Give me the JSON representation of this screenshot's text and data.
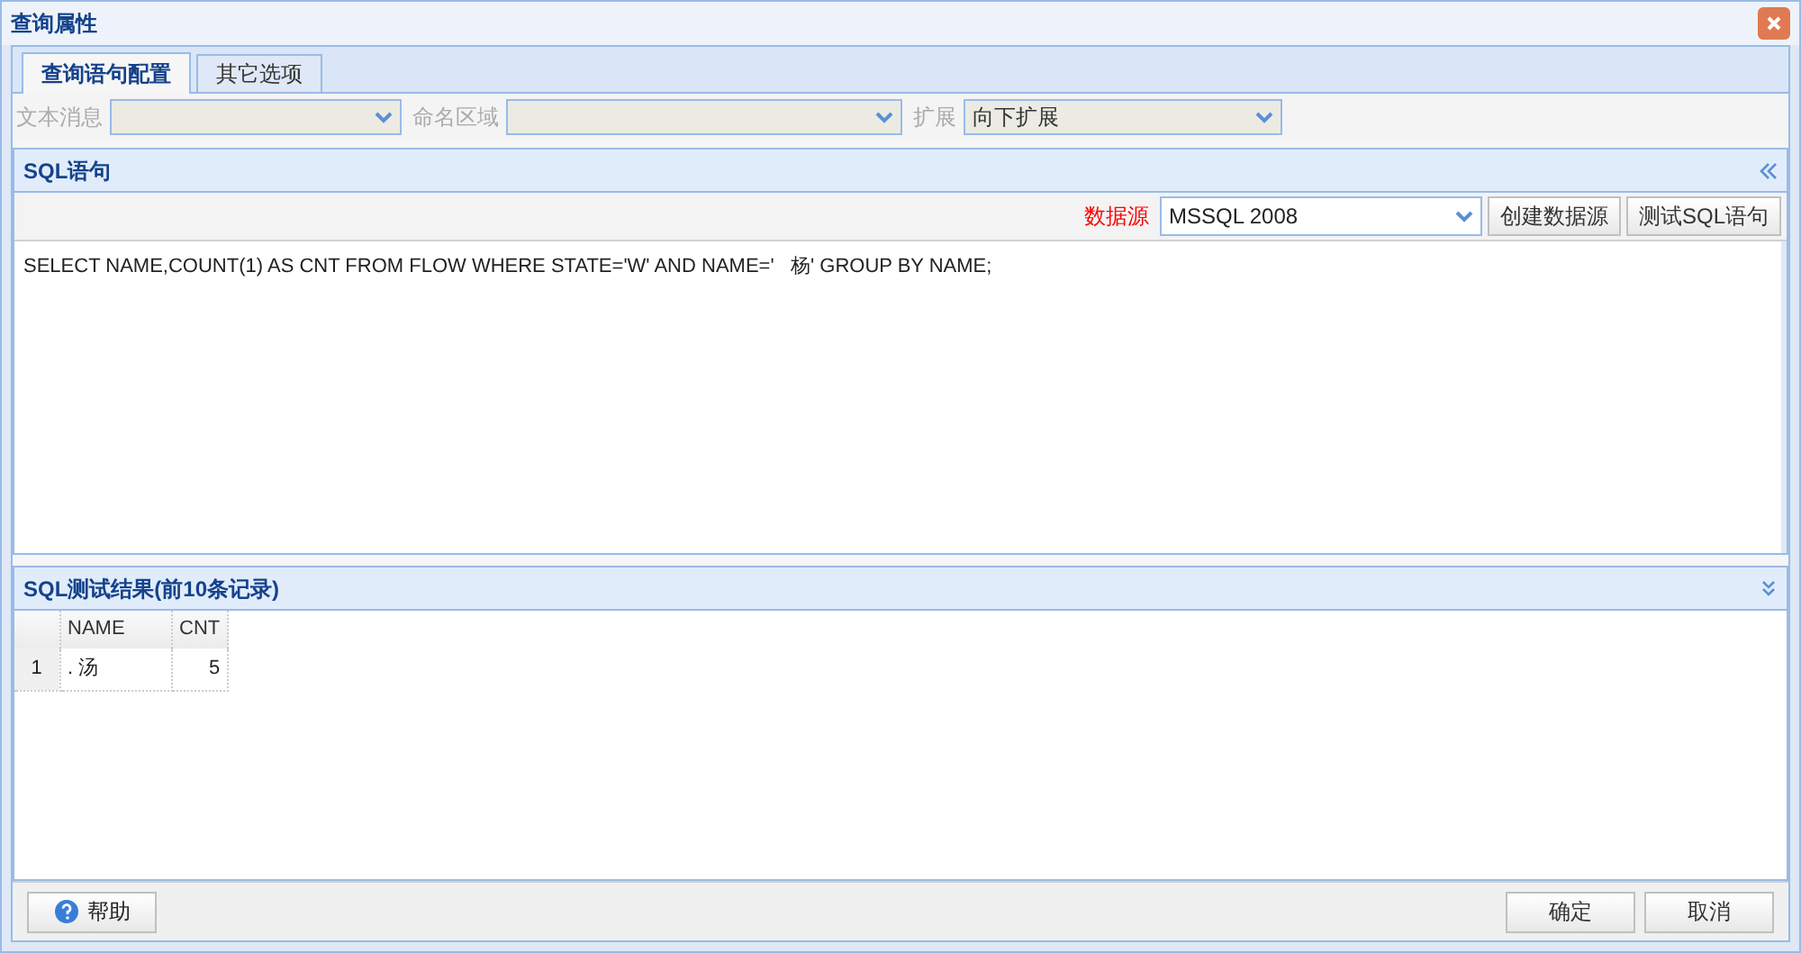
{
  "window": {
    "title": "查询属性"
  },
  "tabs": [
    {
      "label": "查询语句配置",
      "selected": true
    },
    {
      "label": "其它选项",
      "selected": false
    }
  ],
  "filters": [
    {
      "label": "文本消息",
      "disabled": true
    },
    {
      "label": "命名区域",
      "disabled": true
    },
    {
      "label": "扩展",
      "value": "向下扩展",
      "disabled": true
    }
  ],
  "sql_panel": {
    "title": "SQL语句",
    "datasource_label": "数据源",
    "datasource": "MSSQL 2008",
    "buttons": [
      "创建数据源",
      "测试SQL语句"
    ],
    "sql": "SELECT NAME,COUNT(1) AS CNT FROM FLOW WHERE STATE='W' AND NAME='   杨' GROUP BY NAME;"
  },
  "results_panel": {
    "title": "SQL测试结果(前10条记录)",
    "columns": [
      "NAME",
      "CNT"
    ],
    "rows": [
      {
        "number": "1",
        "cells": [
          ". 汤",
          "5"
        ]
      }
    ]
  },
  "footer": {
    "help": "帮助",
    "buttons": [
      "确定",
      "取消"
    ]
  }
}
